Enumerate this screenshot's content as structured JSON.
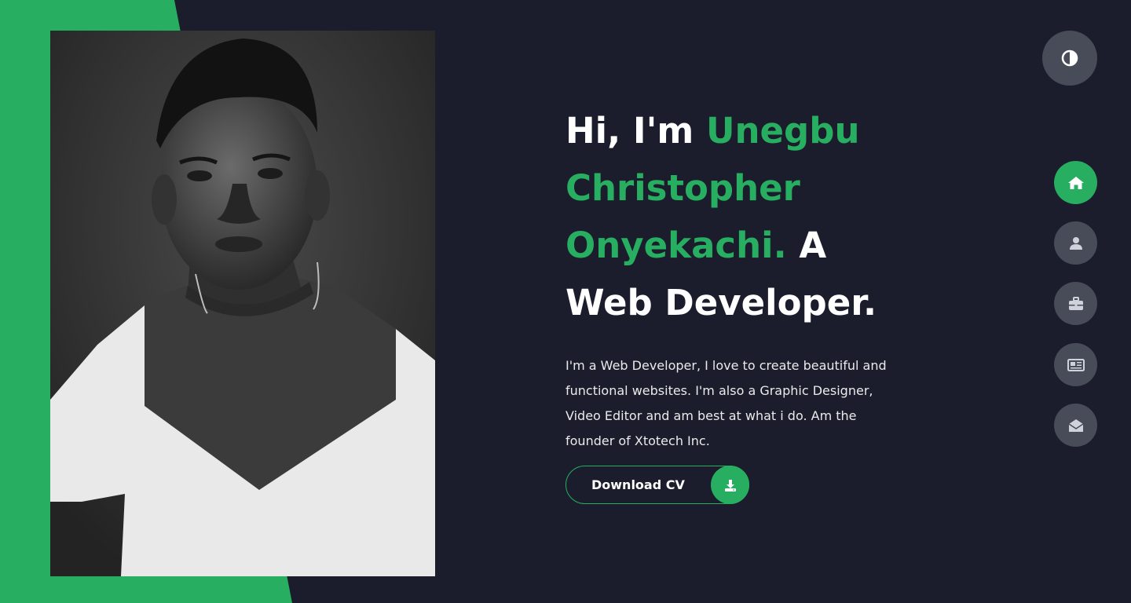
{
  "hero": {
    "greeting": "Hi, I'm ",
    "name_line1": "Unegbu",
    "name_line2": "Christopher",
    "name_line3": "Onyekachi.",
    "role_prefix": " A",
    "role": "Web Developer.",
    "description": "I'm a Web Developer, I love to create beautiful and functional websites. I'm also a Graphic Designer, Video Editor and am best at what i do. Am the founder of Xtotech Inc.",
    "cta_label": "Download CV",
    "cta_icon": "download-icon"
  },
  "theme_toggle": {
    "icon": "contrast-icon"
  },
  "nav": [
    {
      "icon": "home-icon",
      "active": true
    },
    {
      "icon": "user-icon",
      "active": false
    },
    {
      "icon": "briefcase-icon",
      "active": false
    },
    {
      "icon": "newspaper-icon",
      "active": false
    },
    {
      "icon": "envelope-open-icon",
      "active": false
    }
  ],
  "colors": {
    "accent": "#27ae60",
    "background": "#1b1d2c",
    "nav_inactive": "#484c58"
  }
}
